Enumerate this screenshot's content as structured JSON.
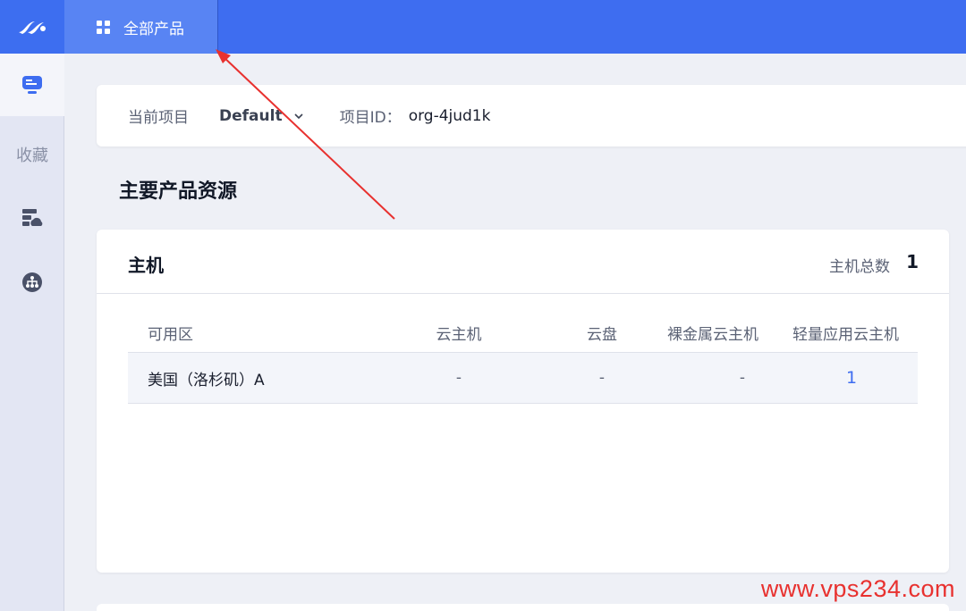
{
  "topbar": {
    "all_products_label": "全部产品"
  },
  "sidebar": {
    "favorites_label": "收藏",
    "items": [
      {
        "icon": "monitor-icon",
        "active": true
      },
      {
        "icon": "server-cloud-icon",
        "active": false
      },
      {
        "icon": "network-icon",
        "active": false
      }
    ]
  },
  "project_bar": {
    "current_project_label": "当前项目",
    "current_project_value": "Default",
    "project_id_label": "项目ID：",
    "project_id_value": "org-4jud1k"
  },
  "main": {
    "section_title": "主要产品资源"
  },
  "host_card": {
    "title": "主机",
    "total_label": "主机总数",
    "total_value": "1",
    "columns": [
      "可用区",
      "云主机",
      "云盘",
      "裸金属云主机",
      "轻量应用云主机"
    ],
    "rows": [
      {
        "zone": "美国（洛杉矶）A",
        "cloud_host": "-",
        "cloud_disk": "-",
        "bare_metal": "-",
        "lightweight": "1"
      }
    ]
  },
  "watermark": "www.vps234.com",
  "colors": {
    "primary": "#3e6df0",
    "annotation_arrow": "#e8312f"
  }
}
